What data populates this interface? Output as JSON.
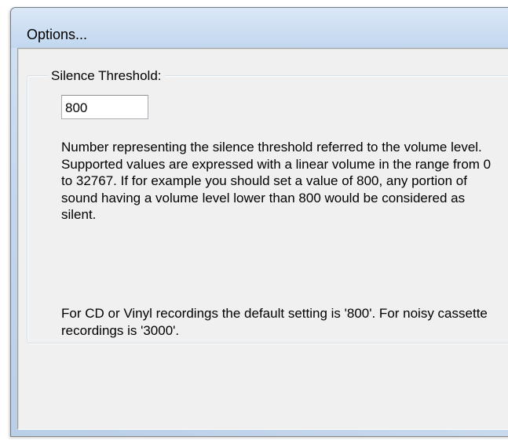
{
  "window": {
    "title": "Options..."
  },
  "silence_threshold": {
    "group_label": "Silence Threshold:",
    "value": "800",
    "description": "Number representing the silence threshold referred to the volume level. Supported values are expressed with a linear volume in the range from 0 to 32767. If for example you should set a value of 800, any portion of sound having a volume level lower than 800 would be considered as silent.",
    "note": "For CD or Vinyl recordings the default setting is '800'. For noisy cassette recordings is '3000'."
  }
}
